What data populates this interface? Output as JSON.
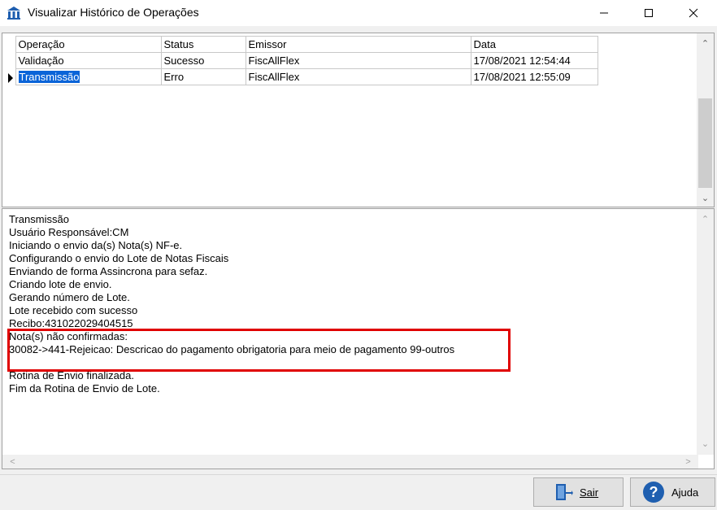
{
  "window": {
    "title": "Visualizar Histórico de Operações",
    "icon": "bank-columns-icon"
  },
  "grid": {
    "columns": [
      "Operação",
      "Status",
      "Emissor",
      "Data"
    ],
    "rows": [
      {
        "operacao": "Validação",
        "status": "Sucesso",
        "emissor": "FiscAllFlex",
        "data": "17/08/2021 12:54:44",
        "selected": false
      },
      {
        "operacao": "Transmissão",
        "status": "Erro",
        "emissor": "FiscAllFlex",
        "data": "17/08/2021 12:55:09",
        "selected": true
      }
    ]
  },
  "log": {
    "lines": [
      "Transmissão",
      "Usuário Responsável:CM",
      "Iniciando o envio da(s) Nota(s) NF-e.",
      "Configurando o envio do Lote de Notas Fiscais",
      "Enviando de forma Assincrona para sefaz.",
      "Criando lote de envio.",
      "Gerando número de Lote.",
      "Lote recebido com sucesso",
      "Recibo:431022029404515",
      "Nota(s) não confirmadas:",
      "30082->441-Rejeicao: Descricao do pagamento obrigatoria para meio de pagamento 99-outros",
      "",
      "Rotina de Envio finalizada.",
      "Fim da Rotina de Envio de Lote."
    ],
    "highlight_color": "#e00000"
  },
  "buttons": {
    "sair": {
      "label": "Sair",
      "icon": "exit-door-icon"
    },
    "ajuda": {
      "label": "Ajuda",
      "icon": "help-question-icon"
    }
  },
  "colors": {
    "selection": "#0a64d8",
    "accent_icon": "#1f5fb0"
  }
}
